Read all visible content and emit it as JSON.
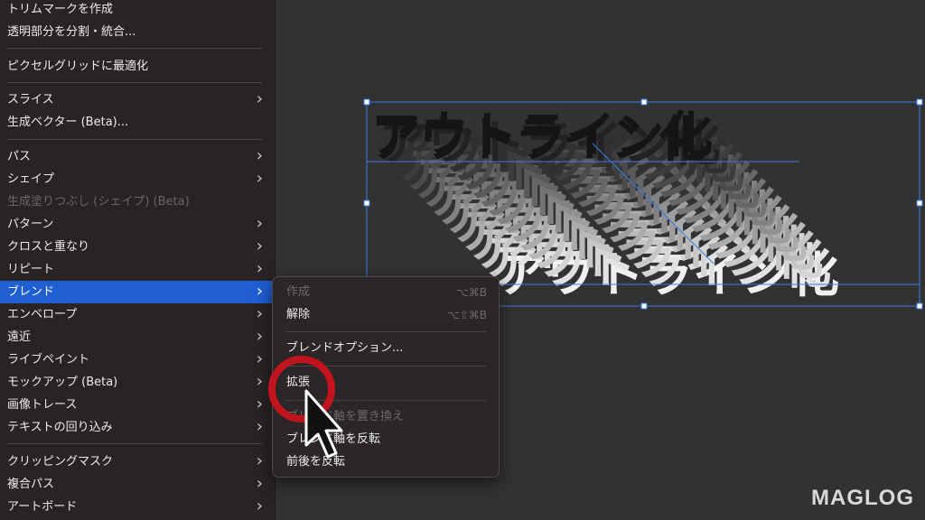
{
  "menu": {
    "items": [
      {
        "label": "トリムマークを作成"
      },
      {
        "label": "透明部分を分割・統合..."
      },
      {
        "label": "ピクセルグリッドに最適化"
      },
      {
        "label": "スライス"
      },
      {
        "label": "生成ベクター (Beta)..."
      },
      {
        "label": "パス"
      },
      {
        "label": "シェイプ"
      },
      {
        "label": "生成塗りつぶし (シェイプ) (Beta)"
      },
      {
        "label": "パターン"
      },
      {
        "label": "クロスと重なり"
      },
      {
        "label": "リピート"
      },
      {
        "label": "ブレンド"
      },
      {
        "label": "エンベロープ"
      },
      {
        "label": "遠近"
      },
      {
        "label": "ライブペイント"
      },
      {
        "label": "モックアップ (Beta)"
      },
      {
        "label": "画像トレース"
      },
      {
        "label": "テキストの回り込み"
      },
      {
        "label": "クリッピングマスク"
      },
      {
        "label": "複合パス"
      },
      {
        "label": "アートボード"
      }
    ],
    "chevron": "›"
  },
  "submenu": {
    "items": [
      {
        "label": "作成",
        "shortcut": "⌥⌘B"
      },
      {
        "label": "解除",
        "shortcut": "⌥⇧⌘B"
      },
      {
        "label": "ブレンドオプション..."
      },
      {
        "label": "拡張"
      },
      {
        "label": "ブレンド軸を置き換え"
      },
      {
        "label": "ブレンド軸を反転"
      },
      {
        "label": "前後を反転"
      }
    ]
  },
  "artwork": {
    "text": "アウトライン化"
  },
  "watermark": "MAGLOG",
  "colors": {
    "highlight": "#1f5fd1",
    "selection": "#3a7ce6",
    "annotation": "#c1141f"
  }
}
